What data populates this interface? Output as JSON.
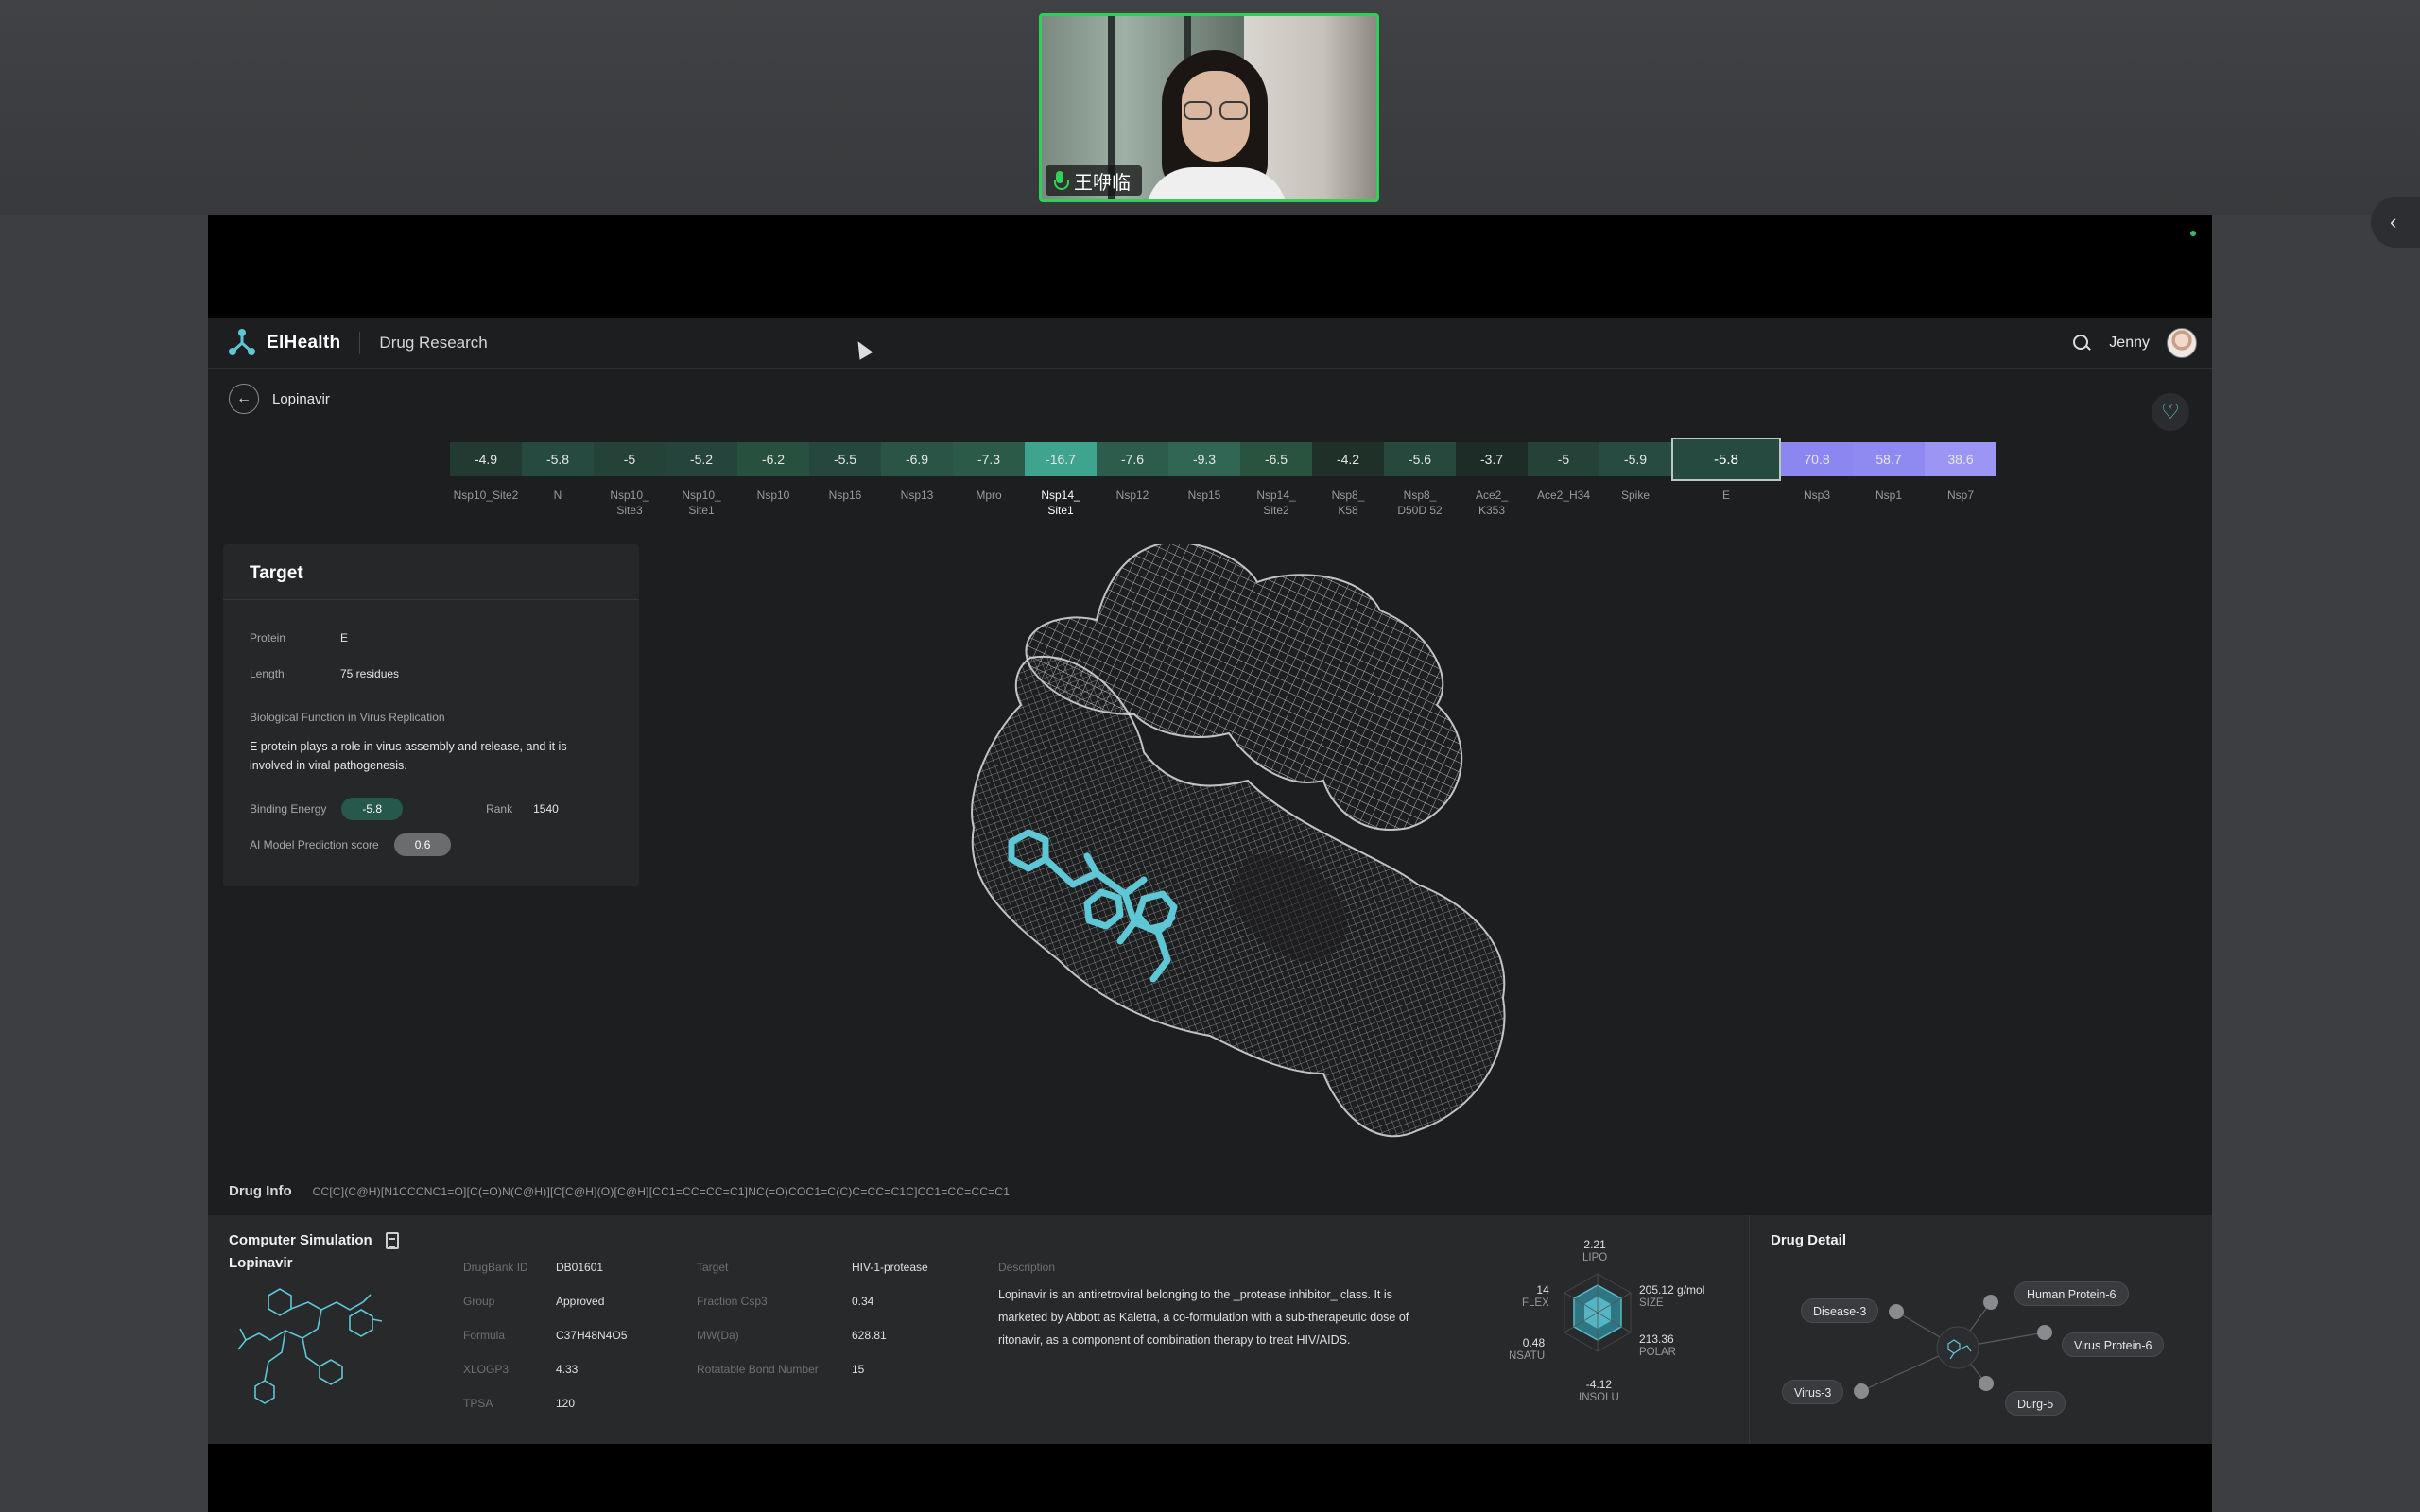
{
  "meeting": {
    "participant_name": "王咿临"
  },
  "app": {
    "brand": "ElHealth",
    "section": "Drug Research",
    "user": "Jenny",
    "breadcrumb": "Lopinavir"
  },
  "energy_strip": {
    "cells": [
      {
        "value": "-4.9",
        "label": "Nsp10_Site2",
        "color": "#233a33"
      },
      {
        "value": "-5.8",
        "label": "N",
        "color": "#274a40"
      },
      {
        "value": "-5",
        "label": "Nsp10_\nSite3",
        "color": "#254239"
      },
      {
        "value": "-5.2",
        "label": "Nsp10_\nSite1",
        "color": "#25443b"
      },
      {
        "value": "-6.2",
        "label": "Nsp10",
        "color": "#28503f"
      },
      {
        "value": "-5.5",
        "label": "Nsp16",
        "color": "#26473d"
      },
      {
        "value": "-6.9",
        "label": "Nsp13",
        "color": "#2a5546"
      },
      {
        "value": "-7.3",
        "label": "Mpro",
        "color": "#2c5a49"
      },
      {
        "value": "-16.7",
        "label": "Nsp14_\nSite1",
        "color": "#3fa48d",
        "active": true
      },
      {
        "value": "-7.6",
        "label": "Nsp12",
        "color": "#2c5c4b"
      },
      {
        "value": "-9.3",
        "label": "Nsp15",
        "color": "#316654"
      },
      {
        "value": "-6.5",
        "label": "Nsp14_\nSite2",
        "color": "#29523f"
      },
      {
        "value": "-4.2",
        "label": "Nsp8_\nK58",
        "color": "#1f3029"
      },
      {
        "value": "-5.6",
        "label": "Nsp8_\nD50D 52",
        "color": "#26483d"
      },
      {
        "value": "-3.7",
        "label": "Ace2_\nK353",
        "color": "#1e2c27"
      },
      {
        "value": "-5",
        "label": "Ace2_H34",
        "color": "#254239"
      },
      {
        "value": "-5.9",
        "label": "Spike",
        "color": "#274b40"
      },
      {
        "value": "-5.8",
        "label": "E",
        "color": "#274a40",
        "selected": true
      },
      {
        "value": "70.8",
        "label": "Nsp3",
        "color": "#8c86f0"
      },
      {
        "value": "58.7",
        "label": "Nsp1",
        "color": "#8f8af2"
      },
      {
        "value": "38.6",
        "label": "Nsp7",
        "color": "#9b96f4"
      }
    ]
  },
  "target": {
    "title": "Target",
    "protein_label": "Protein",
    "protein": "E",
    "length_label": "Length",
    "length": "75 residues",
    "bio_label": "Biological Function in Virus Replication",
    "bio_text": "E protein plays a role in virus assembly and release, and it is involved in viral pathogenesis.",
    "binding_label": "Binding Energy",
    "binding": "-5.8",
    "rank_label": "Rank",
    "rank": "1540",
    "ai_label": "AI Model Prediction score",
    "ai_score": "0.6"
  },
  "drug_info": {
    "label": "Drug Info",
    "smiles": "CC[C](C@H)[N1CCCNC1=O][C(=O)N(C@H)][C[C@H](O)[C@H][CC1=CC=CC=C1]NC(=O)COC1=C(C)C=CC=C1C]CC1=CC=CC=C1"
  },
  "simulation": {
    "title": "Computer Simulation",
    "drug": "Lopinavir",
    "fields_col1": [
      {
        "label": "DrugBank ID",
        "value": "DB01601"
      },
      {
        "label": "Group",
        "value": "Approved"
      },
      {
        "label": "Formula",
        "value": "C37H48N4O5"
      },
      {
        "label": "XLOGP3",
        "value": "4.33"
      },
      {
        "label": "TPSA",
        "value": "120"
      }
    ],
    "fields_col2": [
      {
        "label": "Target",
        "value": "HIV-1-protease"
      },
      {
        "label": "Fraction Csp3",
        "value": "0.34"
      },
      {
        "label": "MW(Da)",
        "value": "628.81"
      },
      {
        "label": "Rotatable Bond Number",
        "value": "15"
      }
    ],
    "desc_label": "Description",
    "description": "Lopinavir is an antiretroviral belonging to the _protease inhibitor_ class. It is marketed by Abbott as Kaletra, a co-formulation with a sub-therapeutic dose of ritonavir, as a component of combination therapy to treat HIV/AIDS.",
    "radar": {
      "lipo": {
        "value": "2.21",
        "name": "LIPO"
      },
      "size": {
        "value": "205.12 g/mol",
        "name": "SIZE"
      },
      "polar": {
        "value": "213.36",
        "name": "POLAR"
      },
      "insolu": {
        "value": "-4.12",
        "name": "INSOLU"
      },
      "nsatu": {
        "value": "0.48",
        "name": "NSATU"
      },
      "flex": {
        "value": "14",
        "name": "FLEX"
      }
    }
  },
  "drug_detail": {
    "title": "Drug Detail",
    "nodes": {
      "human_protein": "Human Protein-6",
      "disease": "Disease-3",
      "virus_protein": "Virus Protein-6",
      "virus": "Virus-3",
      "drug": "Durg-5"
    }
  },
  "colors": {
    "accent": "#5ec7d6",
    "speaker_border": "#2fcf5a",
    "app_bg": "#1d1e20"
  }
}
